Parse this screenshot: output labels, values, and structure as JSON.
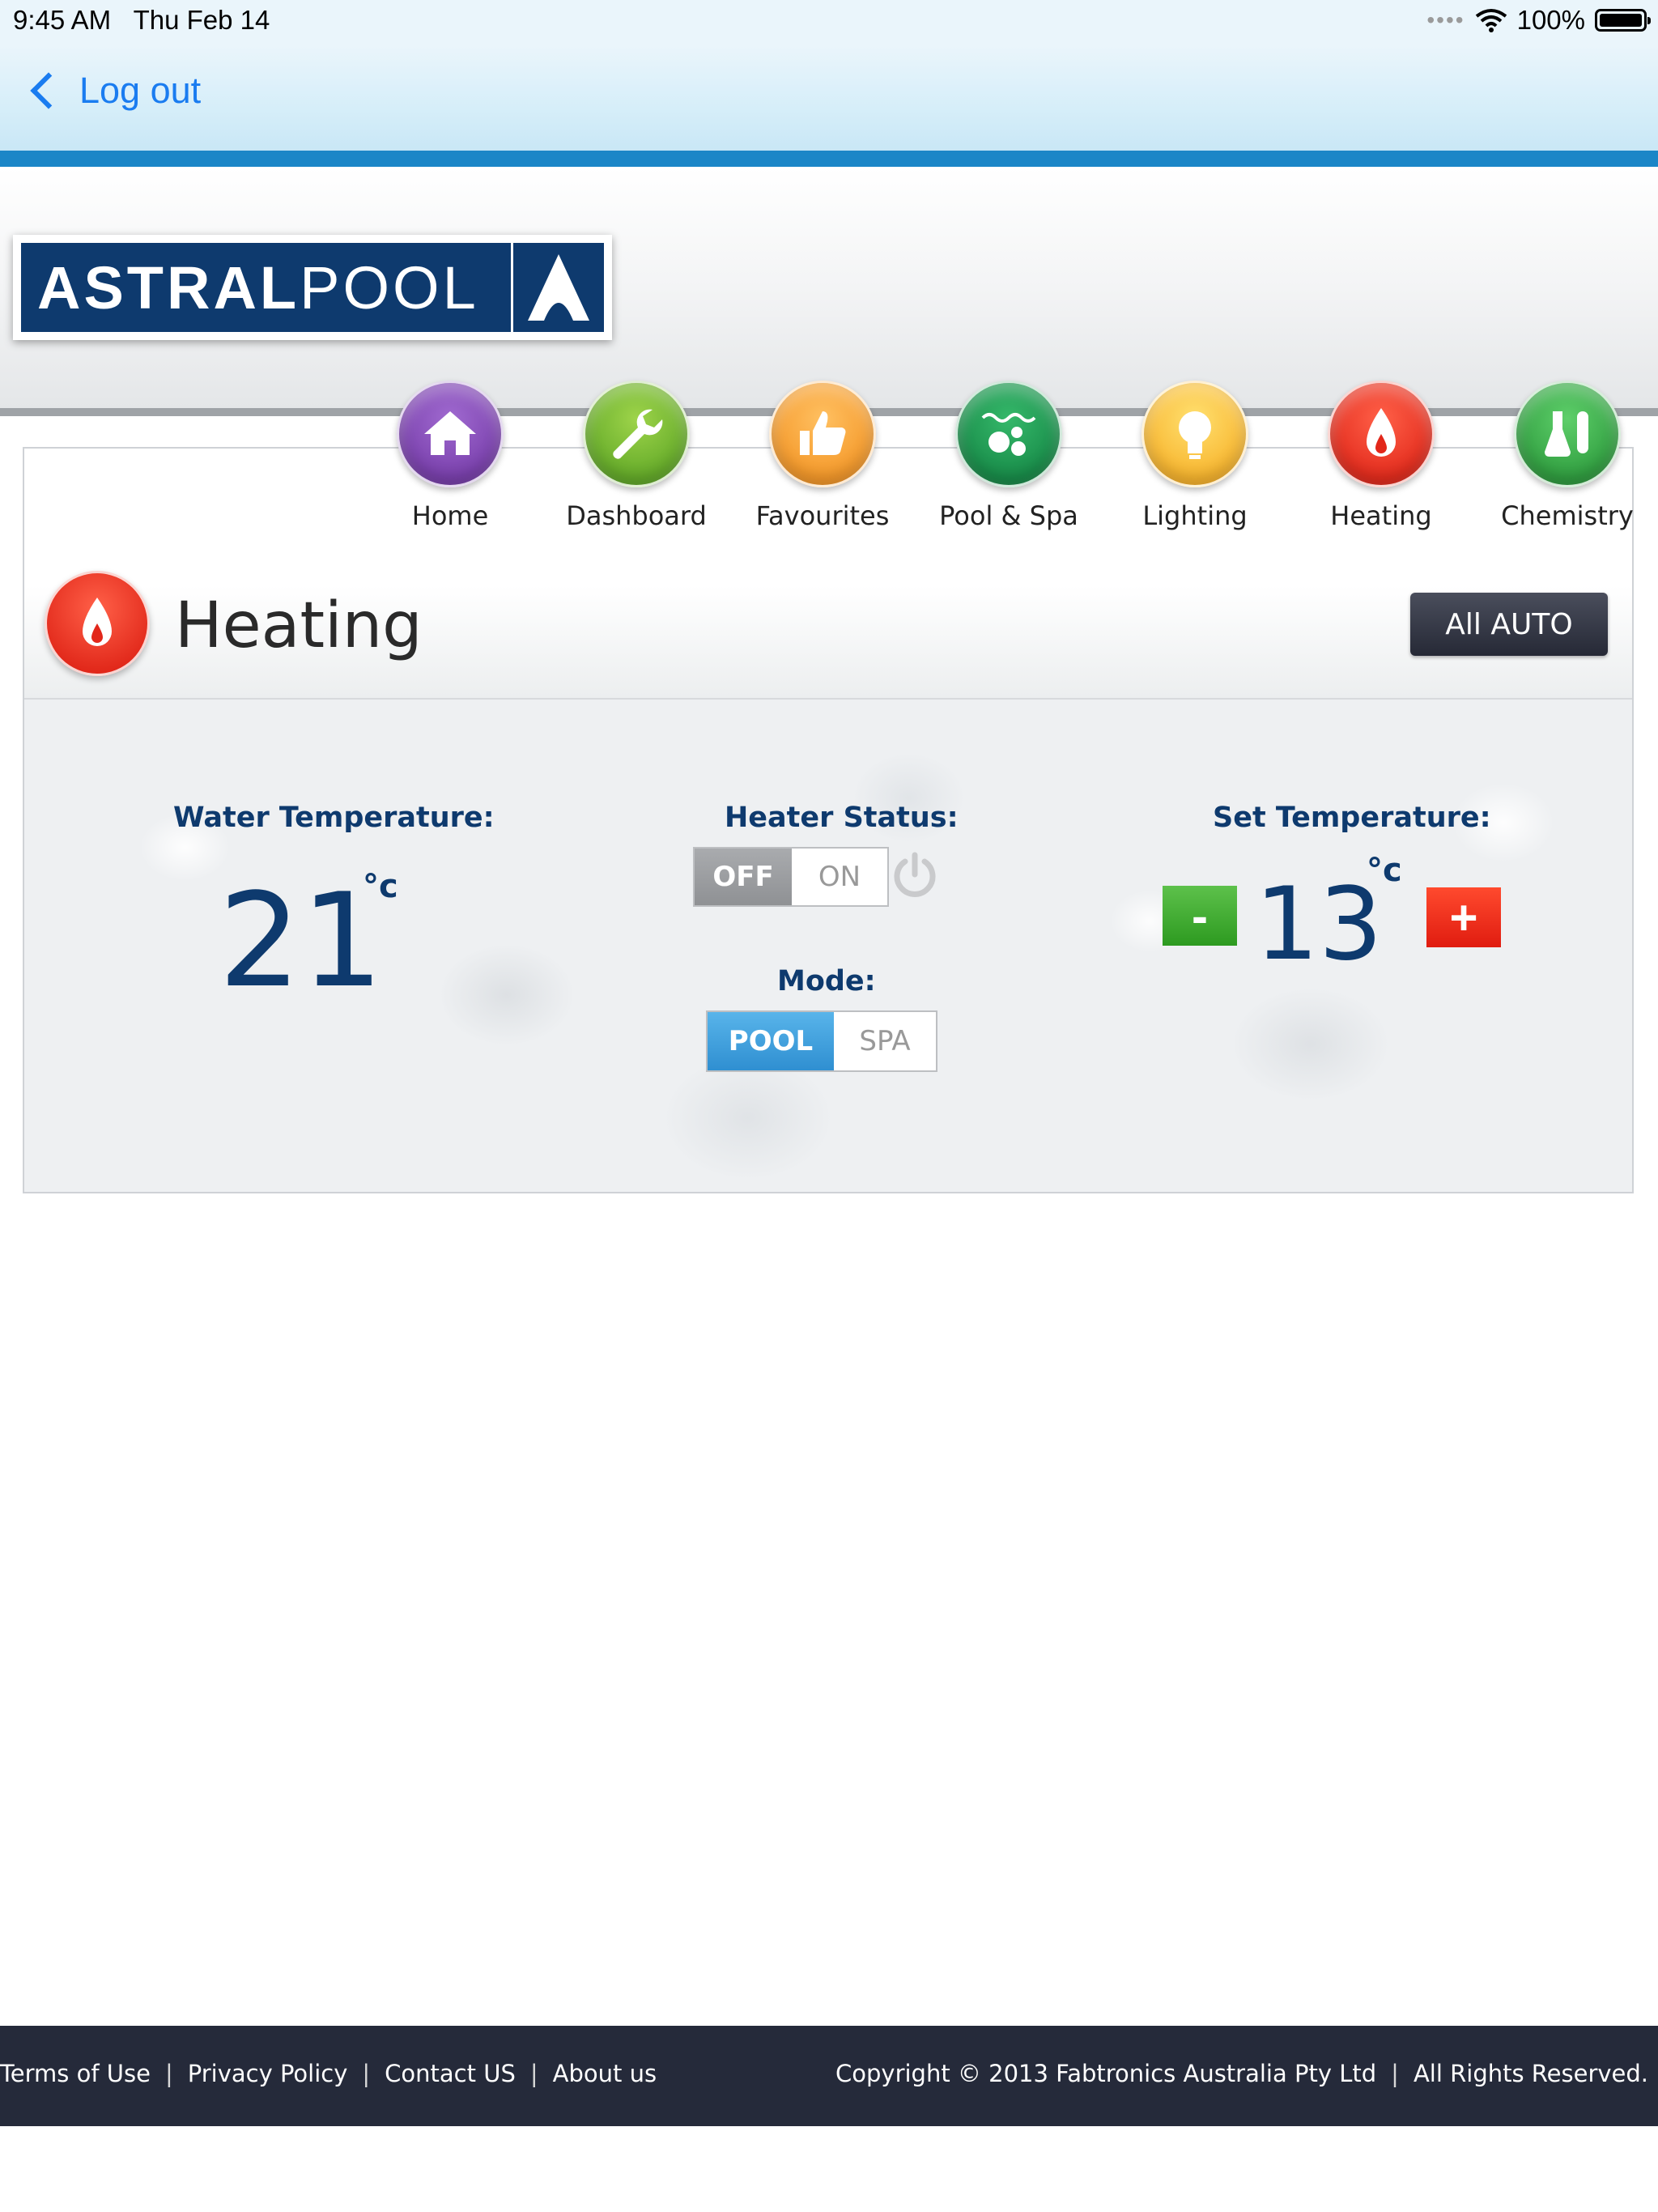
{
  "status_bar": {
    "time": "9:45 AM",
    "date": "Thu Feb 14",
    "battery": "100%"
  },
  "nav": {
    "back_label": "Log out"
  },
  "brand": {
    "logo_bold": "ASTRAL",
    "logo_light": "POOL"
  },
  "menu": {
    "items": [
      {
        "label": "Home",
        "icon": "home-icon"
      },
      {
        "label": "Dashboard",
        "icon": "wrench-icon"
      },
      {
        "label": "Favourites",
        "icon": "thumbs-up-icon"
      },
      {
        "label": "Pool & Spa",
        "icon": "bubbles-icon"
      },
      {
        "label": "Lighting",
        "icon": "light-bulb-icon"
      },
      {
        "label": "Heating",
        "icon": "flame-icon"
      },
      {
        "label": "Chemistry",
        "icon": "flask-icon"
      }
    ]
  },
  "heating": {
    "title": "Heating",
    "all_auto_label": "All AUTO",
    "water_temp_label": "Water Temperature:",
    "water_temp_value": "21",
    "unit": "°c",
    "heater_status_label": "Heater Status:",
    "heater_off": "OFF",
    "heater_on": "ON",
    "heater_state": "OFF",
    "mode_label": "Mode:",
    "mode_pool": "POOL",
    "mode_spa": "SPA",
    "mode_selected": "POOL",
    "set_temp_label": "Set Temperature:",
    "set_temp_value": "13",
    "minus_label": "-",
    "plus_label": "+"
  },
  "footer": {
    "terms": "Terms of Use",
    "privacy": "Privacy Policy",
    "contact": "Contact US",
    "about": "About us",
    "separator": "|",
    "copyright": "Copyright © 2013 Fabtronics Australia Pty Ltd",
    "rights": "All Rights Reserved."
  },
  "colors": {
    "accent_blue": "#1b86c7",
    "navy": "#0e3a6e",
    "footer_bg": "#252a3a",
    "ios_link": "#1a7cf0"
  }
}
